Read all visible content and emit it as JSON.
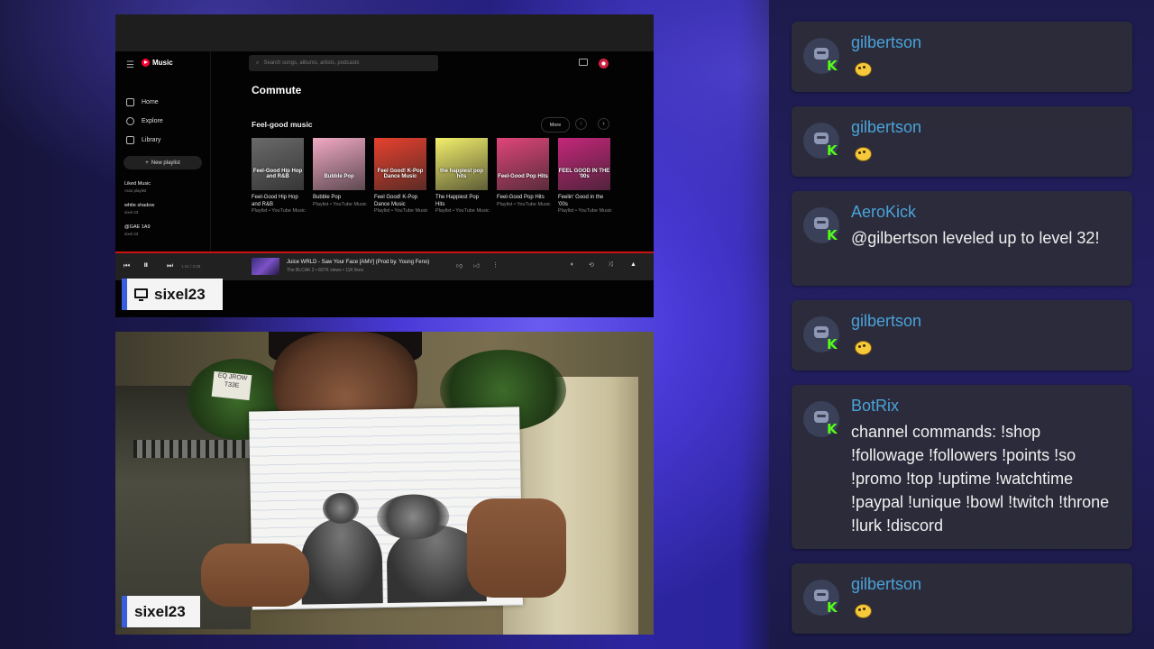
{
  "screen": {
    "app_name": "Music",
    "search_placeholder": "Search songs, albums, artists, podcasts",
    "nav": [
      "Home",
      "Explore",
      "Library"
    ],
    "new_playlist": "New playlist",
    "playlists": [
      {
        "name": "Liked Music",
        "sub": "Auto playlist"
      },
      {
        "name": "white shadow",
        "sub": "sixel 23"
      },
      {
        "name": "@GAE 1A9",
        "sub": "sixel 23"
      }
    ],
    "page_heading": "Commute",
    "shelf_title": "Feel-good music",
    "more_label": "More",
    "cards": [
      {
        "thumb_text": "Feel-Good Hip Hop and R&B",
        "title": "Feel-Good Hip Hop and R&B",
        "sub": "Playlist • YouTube Music",
        "color": "#6a6a6a"
      },
      {
        "thumb_text": "Bubble Pop",
        "title": "Bubble Pop",
        "sub": "Playlist • YouTube Music",
        "color": "#f1a9c4"
      },
      {
        "thumb_text": "Feel Good! K-Pop Dance Music",
        "title": "Feel Good! K-Pop Dance Music",
        "sub": "Playlist • YouTube Music",
        "color": "#e8412e"
      },
      {
        "thumb_text": "the happiest pop hits",
        "title": "The Happiest Pop Hits",
        "sub": "Playlist • YouTube Music",
        "color": "#f2ef6b"
      },
      {
        "thumb_text": "Feel-Good Pop Hits",
        "title": "Feel-Good Pop Hits",
        "sub": "Playlist • YouTube Music",
        "color": "#e0457a"
      },
      {
        "thumb_text": "FEEL GOOD IN THE '00s",
        "title": "Feelin' Good in the '00s",
        "sub": "Playlist • YouTube Music",
        "color": "#c4267a"
      }
    ],
    "player": {
      "time": "1:41 / 3:28",
      "track_title": "Juice WRLD - Saw Your Face [AMV] (Prod by. Young Feno)",
      "track_sub": "The BLCAK 2 • 837K views • 11K likes"
    },
    "source_label": "sixel23"
  },
  "webcam": {
    "source_label": "sixel23",
    "note_text": "EQ JROW T33E"
  },
  "chat": {
    "messages": [
      {
        "user": "gilbertson",
        "text": "",
        "emote": true
      },
      {
        "user": "gilbertson",
        "text": "",
        "emote": true
      },
      {
        "user": "AeroKick",
        "text": "@gilbertson leveled up to level 32!",
        "emote": false
      },
      {
        "user": "gilbertson",
        "text": "",
        "emote": true
      },
      {
        "user": "BotRix",
        "text": "channel commands: !shop !followage !followers !points !so !promo !top !uptime !watchtime !paypal !unique !bowl !twitch !throne !lurk !discord",
        "emote": false
      },
      {
        "user": "gilbertson",
        "text": "",
        "emote": true
      }
    ]
  },
  "colors": {
    "accent_blue": "#3a5ee0",
    "kick_green": "#53fc18",
    "username_blue": "#4aa3d8",
    "yt_red": "#ff0033"
  }
}
